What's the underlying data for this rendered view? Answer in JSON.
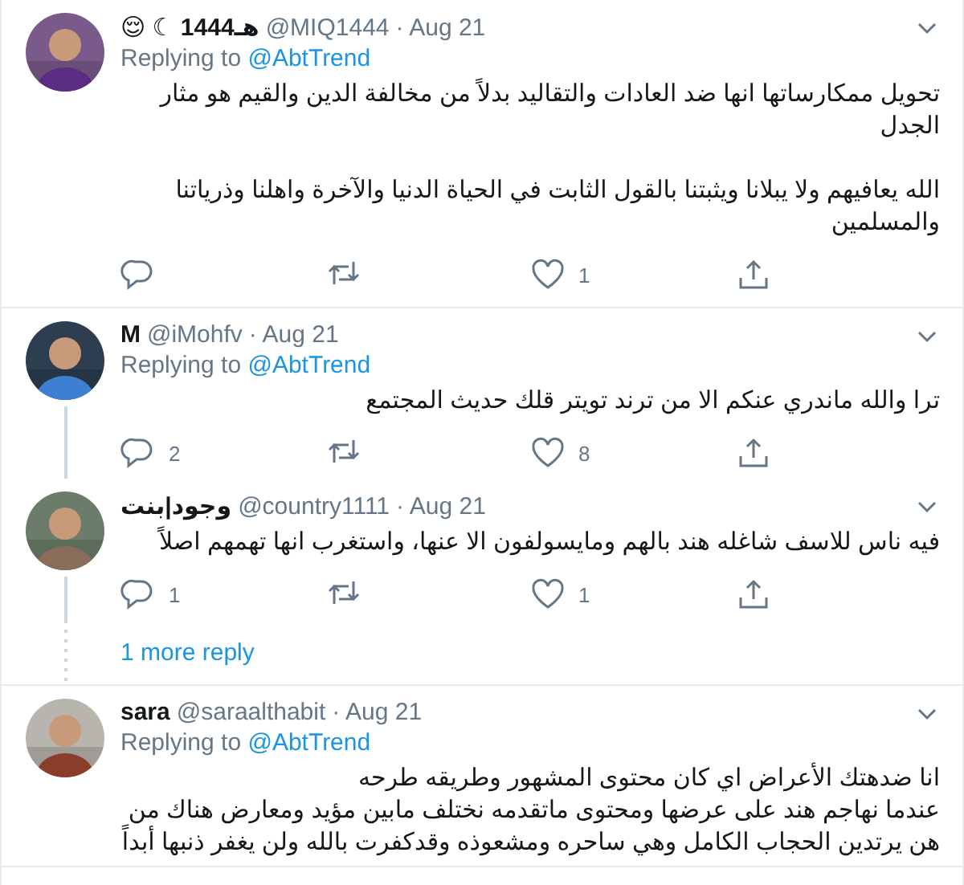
{
  "items": [
    {
      "kind": "tweet",
      "name": "😌 ☾ هـ1444",
      "handle": "@MIQ1444",
      "date": "· Aug 21",
      "replying_label": "Replying to",
      "replying_to": "@AbtTrend",
      "paragraphs": [
        "تحويل ممكارساتها انها ضد العادات والتقاليد بدلاً من مخالفة الدين والقيم هو مثار الجدل",
        "الله يعافيهم ولا يبلانا ويثبتنا بالقول الثابت في الحياة الدنيا والآخرة واهلنا وذرياتنا والمسلمين"
      ],
      "likes": "1",
      "thread": false
    },
    {
      "kind": "tweet",
      "name": "M",
      "handle": "@iMohfv",
      "date": "· Aug 21",
      "replying_label": "Replying to",
      "replying_to": "@AbtTrend",
      "paragraphs": [
        "ترا والله ماندري عنكم الا من ترند تويتر قلك حديث المجتمع"
      ],
      "replies": "2",
      "likes": "8",
      "thread": true
    },
    {
      "kind": "tweet",
      "name": "وجود|بنت",
      "handle": "@country1111",
      "date": "· Aug 21",
      "paragraphs": [
        "فيه ناس للاسف شاغله هند بالهم ومايسولفون الا عنها، واستغرب انها تهمهم اصلاً"
      ],
      "replies": "1",
      "likes": "1",
      "thread": true
    },
    {
      "kind": "more_replies",
      "label": "1 more reply"
    },
    {
      "kind": "tweet",
      "name": "sara",
      "handle": "@saraalthabit",
      "date": "· Aug 21",
      "replying_label": "Replying to",
      "replying_to": "@AbtTrend",
      "paragraphs": [
        "انا ضدهتك الأعراض اي كان محتوى المشهور وطريقه طرحه\nعندما نهاجم هند على عرضها ومحتوى ماتقدمه نختلف مابين مؤيد ومعارض هناك من هن يرتدين الحجاب الكامل وهي ساحره ومشعوذه وقدكفرت بالله ولن يغفر ذنبها أبداً"
      ],
      "thread": false
    }
  ]
}
